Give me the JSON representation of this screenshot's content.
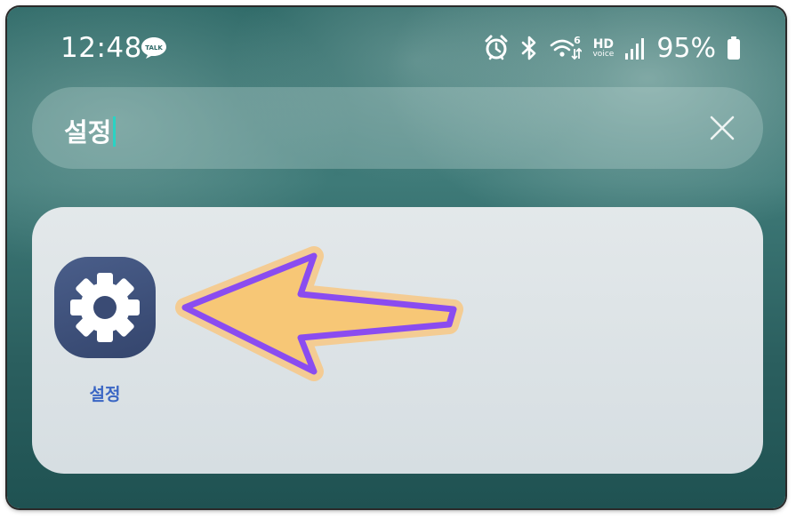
{
  "status_bar": {
    "time": "12:48",
    "battery_percent": "95%",
    "hd_label": "HD",
    "voice_label": "voice",
    "talk_badge": "TALK",
    "wifi_badge": "6",
    "icons": [
      "talk-icon",
      "alarm-icon",
      "bluetooth-icon",
      "wifi-6-icon",
      "hd-voice-icon",
      "signal-icon",
      "battery-icon"
    ]
  },
  "search": {
    "query": "설정",
    "clear_icon": "close-icon"
  },
  "results": {
    "apps": [
      {
        "label": "설정",
        "icon": "gear-icon"
      }
    ]
  },
  "annotation": {
    "icon": "pointer-arrow-icon",
    "fill": "#f7c776",
    "stroke": "#8a4cf0",
    "glow": "#f6c98a"
  }
}
